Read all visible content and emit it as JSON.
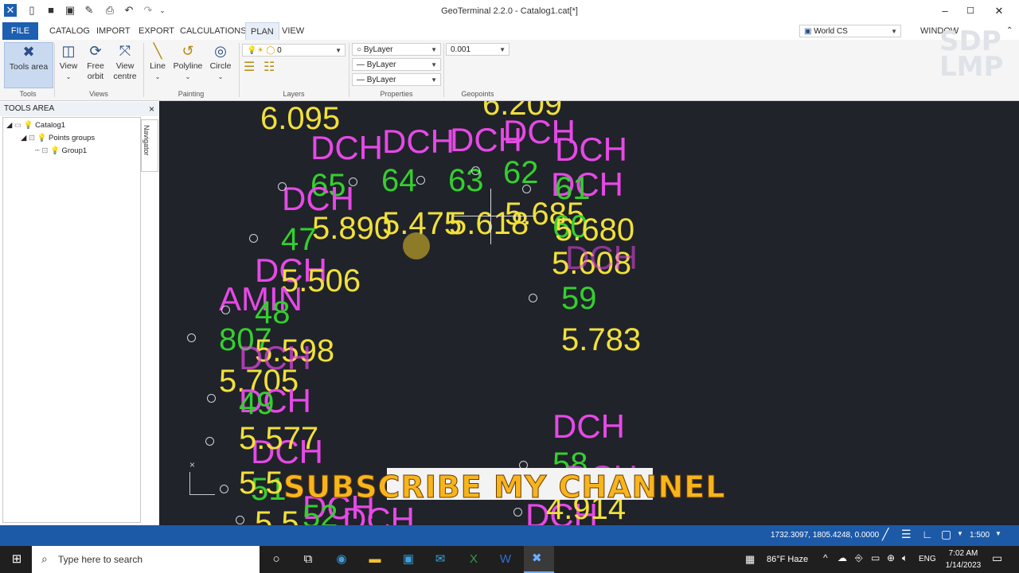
{
  "window": {
    "title": "GeoTerminal 2.2.0 - Catalog1.cat[*]"
  },
  "menu": [
    "FILE",
    "CATALOG",
    "IMPORT",
    "EXPORT",
    "CALCULATIONS",
    "PLAN",
    "VIEW"
  ],
  "coord_system": {
    "value": "World CS"
  },
  "window_menu": "WINDOW",
  "ribbon": {
    "tools": {
      "button": "Tools area",
      "group": "Tools"
    },
    "views": {
      "buttons": [
        "View",
        "Free orbit",
        "View centre"
      ],
      "group": "Views"
    },
    "painting": {
      "buttons": [
        "Line",
        "Polyline",
        "Circle"
      ],
      "group": "Painting"
    },
    "layers": {
      "value": "0",
      "group": "Layers"
    },
    "properties": {
      "color": "ByLayer",
      "linetype": "ByLayer",
      "lineweight": "ByLayer",
      "group": "Properties"
    },
    "geopoints": {
      "value": "0.001",
      "group": "Geopoints"
    }
  },
  "tools_area": {
    "title": "TOOLS AREA",
    "close": "×",
    "tree": [
      "Catalog1",
      "Points groups",
      "Group1"
    ],
    "navigator": "Navigator"
  },
  "canvas": {
    "labels": [
      {
        "t": "6.095"
      },
      {
        "t": "6.209"
      },
      {
        "t": "DCH"
      },
      {
        "t": "DCH"
      },
      {
        "t": "DCH"
      },
      {
        "t": "DCH"
      },
      {
        "t": "DCH"
      },
      {
        "t": "65"
      },
      {
        "t": "64"
      },
      {
        "t": "63"
      },
      {
        "t": "62"
      },
      {
        "t": "DCH"
      },
      {
        "t": "DCH"
      },
      {
        "t": "61"
      },
      {
        "t": "5.890"
      },
      {
        "t": "5.475"
      },
      {
        "t": "5.618"
      },
      {
        "t": "5.685"
      },
      {
        "t": "60"
      },
      {
        "t": "5.680"
      },
      {
        "t": "47"
      },
      {
        "t": "DCH"
      },
      {
        "t": "5.506"
      },
      {
        "t": "5.608"
      },
      {
        "t": "DCH"
      },
      {
        "t": "AMIN"
      },
      {
        "t": "48"
      },
      {
        "t": "59"
      },
      {
        "t": "807"
      },
      {
        "t": "5.598"
      },
      {
        "t": "DCH"
      },
      {
        "t": "5.783"
      },
      {
        "t": "5.705"
      },
      {
        "t": "DCH"
      },
      {
        "t": "49"
      },
      {
        "t": "DCH"
      },
      {
        "t": "5.577"
      },
      {
        "t": "DCH"
      },
      {
        "t": "51"
      },
      {
        "t": "5.5"
      },
      {
        "t": "58"
      },
      {
        "t": "DCH"
      },
      {
        "t": "DCH"
      },
      {
        "t": "DCH"
      },
      {
        "t": "5.5"
      },
      {
        "t": "52"
      },
      {
        "t": "DCH"
      },
      {
        "t": "4.914"
      }
    ]
  },
  "banner": {
    "text": "SUBSCRIBE MY CHANNEL"
  },
  "watermark": "SDP LMP",
  "statusbar": {
    "coords": "1732.3097, 1805.4248, 0.0000",
    "scale": "1:500"
  },
  "taskbar": {
    "search_placeholder": "Type here to search",
    "weather": "86°F  Haze",
    "lang": "ENG",
    "time": "7:02 AM",
    "date": "1/14/2023"
  },
  "colors": {
    "accent": "#1d5fb0",
    "canvas": "#20232a",
    "elevation": "#f1e03a",
    "code": "#e649e6",
    "point_id": "#35cf2f"
  }
}
